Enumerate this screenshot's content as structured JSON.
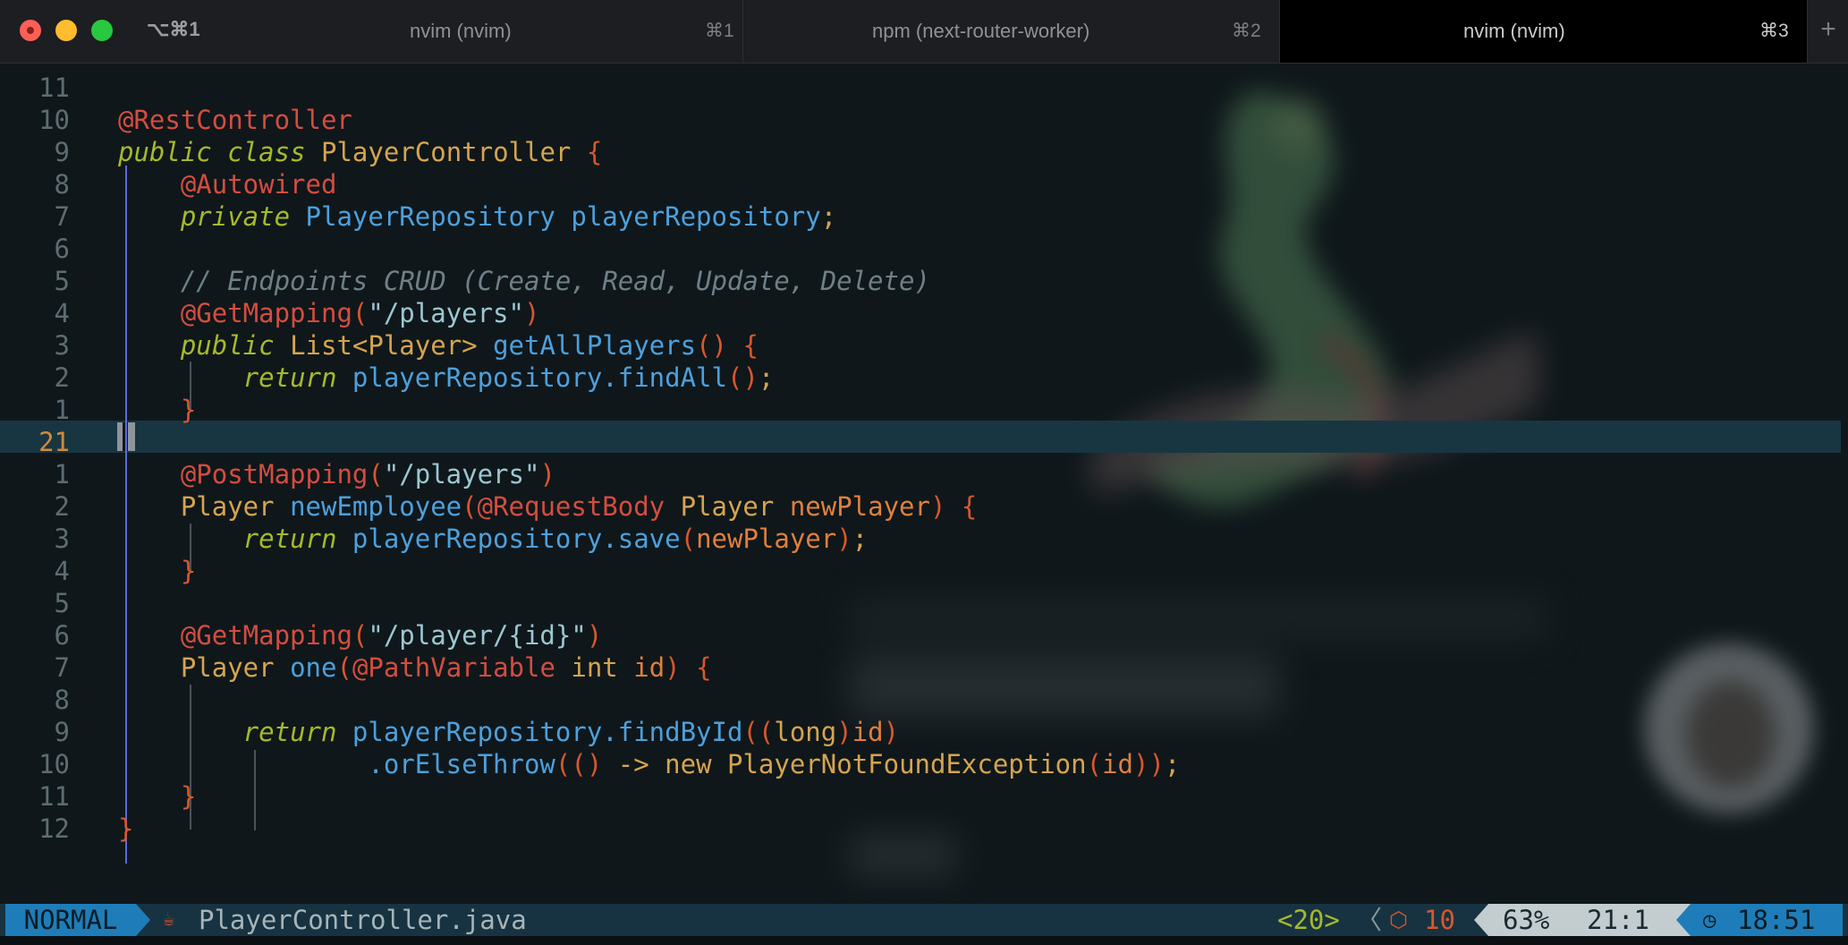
{
  "window": {
    "shortcut": "⌥⌘1",
    "tabs": [
      {
        "title": "nvim (nvim)",
        "key": "⌘1",
        "active": false
      },
      {
        "title": "npm (next-router-worker)",
        "key": "⌘2",
        "active": false
      },
      {
        "title": "nvim (nvim)",
        "key": "⌘3",
        "active": true
      }
    ],
    "new_tab": "+"
  },
  "editor": {
    "line_numbers": [
      "11",
      "10",
      "9",
      "8",
      "7",
      "6",
      "5",
      "4",
      "3",
      "2",
      "1",
      "21",
      "1",
      "2",
      "3",
      "4",
      "5",
      "6",
      "7",
      "8",
      "9",
      "10",
      "11",
      "12"
    ],
    "lines": [
      "",
      "@RestController",
      "public class PlayerController {",
      "    @Autowired",
      "    private PlayerRepository playerRepository;",
      "",
      "    // Endpoints CRUD (Create, Read, Update, Delete)",
      "    @GetMapping(\"/players\")",
      "    public List<Player> getAllPlayers() {",
      "        return playerRepository.findAll();",
      "    }",
      "",
      "    @PostMapping(\"/players\")",
      "    Player newEmployee(@RequestBody Player newPlayer) {",
      "        return playerRepository.save(newPlayer);",
      "    }",
      "",
      "    @GetMapping(\"/player/{id}\")",
      "    Player one(@PathVariable int id) {",
      "",
      "        return playerRepository.findById((long)id)",
      "                .orElseThrow(() -> new PlayerNotFoundException(id));",
      "    }",
      "}"
    ]
  },
  "statusline": {
    "mode": "NORMAL",
    "file_icon": "java-icon",
    "filename": "PlayerController.java",
    "column_indicator": "<20>",
    "separator": "〈",
    "package_icon": "package-icon",
    "package_count": "10",
    "percent": "63%",
    "position": "21:1",
    "time": "18:51"
  },
  "colors": {
    "mode_bg": "#1e7db8",
    "cursorline_bg": "#183642",
    "annotation": "#d44d3f",
    "keyword": "#a6b92b",
    "type": "#d6a44f",
    "function": "#4da0dc",
    "string": "#9cc7cf",
    "comment": "#6f8087"
  }
}
